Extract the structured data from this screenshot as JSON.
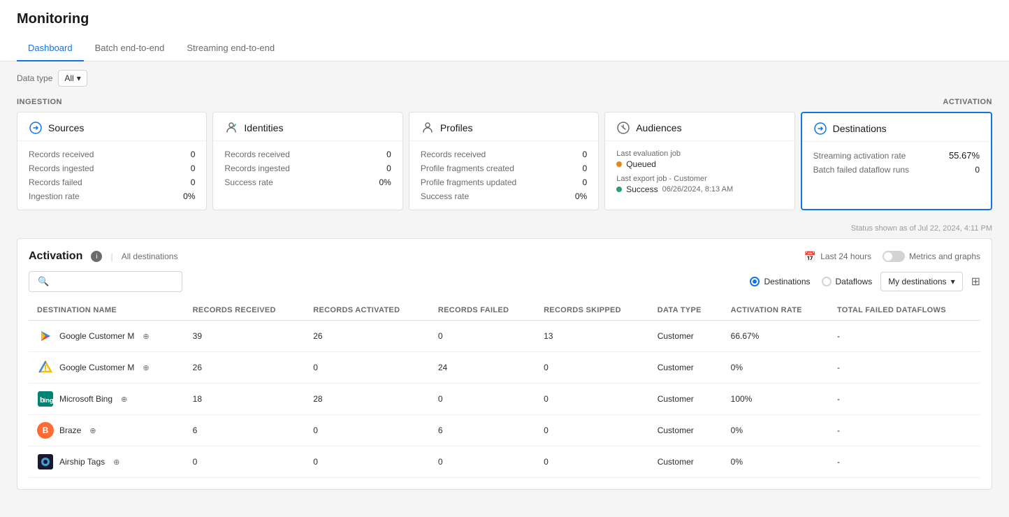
{
  "page": {
    "title": "Monitoring"
  },
  "tabs": [
    {
      "id": "dashboard",
      "label": "Dashboard",
      "active": true
    },
    {
      "id": "batch",
      "label": "Batch end-to-end",
      "active": false
    },
    {
      "id": "streaming",
      "label": "Streaming end-to-end",
      "active": false
    }
  ],
  "data_type": {
    "label": "Data type",
    "value": "All"
  },
  "ingestion_label": "INGESTION",
  "activation_label": "ACTIVATION",
  "cards": {
    "sources": {
      "title": "Sources",
      "metrics": [
        {
          "label": "Records received",
          "value": "0"
        },
        {
          "label": "Records ingested",
          "value": "0"
        },
        {
          "label": "Records failed",
          "value": "0"
        },
        {
          "label": "Ingestion rate",
          "value": "0%"
        }
      ]
    },
    "identities": {
      "title": "Identities",
      "metrics": [
        {
          "label": "Records received",
          "value": "0"
        },
        {
          "label": "Records ingested",
          "value": "0"
        },
        {
          "label": "Success rate",
          "value": "0%"
        }
      ]
    },
    "profiles": {
      "title": "Profiles",
      "metrics": [
        {
          "label": "Records received",
          "value": "0"
        },
        {
          "label": "Profile fragments created",
          "value": "0"
        },
        {
          "label": "Profile fragments updated",
          "value": "0"
        },
        {
          "label": "Success rate",
          "value": "0%"
        }
      ]
    },
    "audiences": {
      "title": "Audiences",
      "eval_label": "Last evaluation job",
      "queued_label": "Queued",
      "queued_status": "orange",
      "export_label": "Last export job - Customer",
      "success_label": "Success",
      "success_time": "06/26/2024, 8:13 AM",
      "success_status": "green"
    },
    "destinations": {
      "title": "Destinations",
      "streaming_label": "Streaming activation rate",
      "streaming_value": "55.67%",
      "batch_label": "Batch failed dataflow runs",
      "batch_value": "0"
    }
  },
  "status_line": "Status shown as of Jul 22, 2024, 4:11 PM",
  "activation": {
    "title": "Activation",
    "info": "i",
    "separator": "|",
    "all_destinations": "All destinations",
    "time_filter": "Last 24 hours",
    "metrics_label": "Metrics and graphs",
    "search_placeholder": "",
    "radio_options": [
      {
        "label": "Destinations",
        "selected": true
      },
      {
        "label": "Dataflows",
        "selected": false
      }
    ],
    "dropdown_label": "My destinations",
    "table_columns": [
      "DESTINATION NAME",
      "RECORDS RECEIVED",
      "RECORDS ACTIVATED",
      "RECORDS FAILED",
      "RECORDS SKIPPED",
      "DATA TYPE",
      "ACTIVATION RATE",
      "TOTAL FAILED DATAFLOWS"
    ],
    "rows": [
      {
        "icon_type": "google-play",
        "name": "Google Customer M",
        "records_received": "39",
        "records_activated": "26",
        "records_failed": "0",
        "records_skipped": "13",
        "data_type": "Customer",
        "activation_rate": "66.67%",
        "total_failed": "-"
      },
      {
        "icon_type": "google-ads",
        "name": "Google Customer M",
        "records_received": "26",
        "records_activated": "0",
        "records_failed": "24",
        "records_skipped": "0",
        "data_type": "Customer",
        "activation_rate": "0%",
        "total_failed": "-"
      },
      {
        "icon_type": "bing",
        "name": "Microsoft Bing",
        "records_received": "18",
        "records_activated": "28",
        "records_failed": "0",
        "records_skipped": "0",
        "data_type": "Customer",
        "activation_rate": "100%",
        "total_failed": "-"
      },
      {
        "icon_type": "braze",
        "name": "Braze",
        "records_received": "6",
        "records_activated": "0",
        "records_failed": "6",
        "records_skipped": "0",
        "data_type": "Customer",
        "activation_rate": "0%",
        "total_failed": "-"
      },
      {
        "icon_type": "airship",
        "name": "Airship Tags",
        "records_received": "0",
        "records_activated": "0",
        "records_failed": "0",
        "records_skipped": "0",
        "data_type": "Customer",
        "activation_rate": "0%",
        "total_failed": "-"
      }
    ]
  }
}
